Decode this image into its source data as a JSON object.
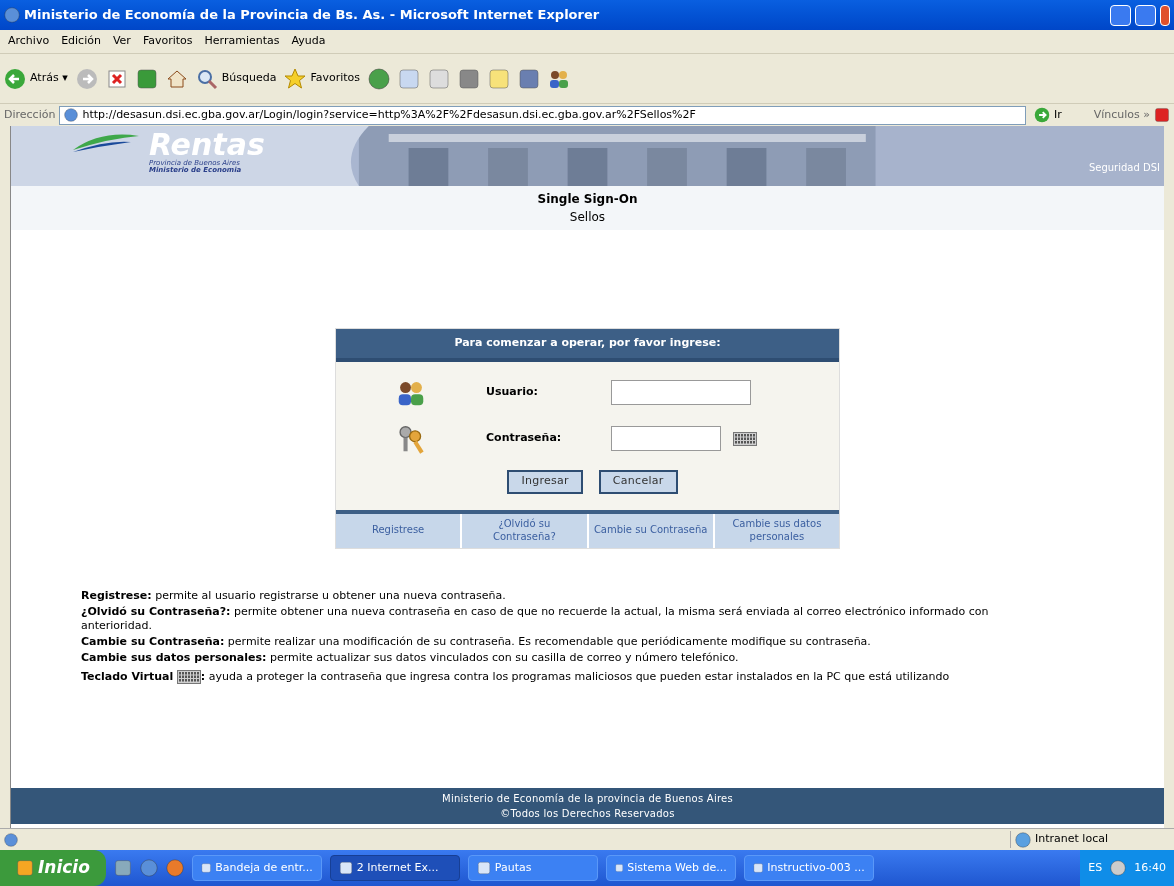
{
  "window": {
    "title": "Ministerio de Economía de la Provincia de Bs. As. - Microsoft Internet Explorer"
  },
  "menu": [
    "Archivo",
    "Edición",
    "Ver",
    "Favoritos",
    "Herramientas",
    "Ayuda"
  ],
  "toolbar": {
    "back": "Atrás",
    "back_caret": "▾",
    "search": "Búsqueda",
    "favorites": "Favoritos"
  },
  "address": {
    "label": "Dirección",
    "url": "http://desasun.dsi.ec.gba.gov.ar/Login/login?service=http%3A%2F%2Fdesasun.dsi.ec.gba.gov.ar%2FSellos%2F",
    "go": "Ir",
    "links": "Vínculos",
    "chevron": "»"
  },
  "banner": {
    "logo": "Rentas",
    "logo_sub1": "Provincia de Buenos Aires",
    "logo_sub2": "Ministerio de Economia",
    "right": "Seguridad DSI"
  },
  "page": {
    "title": "Single Sign-On",
    "subtitle": "Sellos"
  },
  "login": {
    "header": "Para comenzar a operar, por favor ingrese:",
    "fields": [
      {
        "kind": "user",
        "label": "Usuario:"
      },
      {
        "kind": "password",
        "label": "Contraseña:"
      }
    ],
    "buttons": [
      "Ingresar",
      "Cancelar"
    ],
    "links": [
      "Registrese",
      "¿Olvidó su Contraseña?",
      "Cambie su Contraseña",
      "Cambie sus datos personales"
    ]
  },
  "help": [
    {
      "term": "Registrese:",
      "keyboard_icon": false,
      "text": "permite al usuario registrarse u obtener una nueva contraseña."
    },
    {
      "term": "¿Olvidó su Contraseña?:",
      "keyboard_icon": false,
      "text": "permite obtener una nueva contraseña en caso de que no recuerde la actual, la misma será enviada al correo electrónico informado con anterioridad."
    },
    {
      "term": "Cambie su Contraseña:",
      "keyboard_icon": false,
      "text": "permite realizar una modificación de su contraseña. Es recomendable que periódicamente modifique su contraseña."
    },
    {
      "term": "Cambie sus datos personales:",
      "keyboard_icon": false,
      "text": "permite actualizar sus datos vinculados con su casilla de correo y número telefónico."
    },
    {
      "term": "Teclado Virtual",
      "keyboard_icon": true,
      "colon": ":",
      "text": "ayuda a proteger la contraseña que ingresa contra los programas maliciosos que pueden estar instalados en la PC que está utilizando"
    }
  ],
  "footer": [
    "Ministerio de Economía de la provincia de Buenos Aires",
    "©Todos los Derechos Reservados"
  ],
  "status_bar": {
    "zone": "Intranet local"
  },
  "taskbar": {
    "start": "Inicio",
    "tasks": [
      {
        "label": "Bandeja de entr...",
        "selected": false
      },
      {
        "label": "2 Internet Ex...",
        "selected": true
      },
      {
        "label": "Pautas",
        "selected": false
      },
      {
        "label": "Sistema Web de...",
        "selected": false
      },
      {
        "label": "Instructivo-003 ...",
        "selected": false
      }
    ],
    "lang": "ES",
    "clock": "16:40"
  }
}
